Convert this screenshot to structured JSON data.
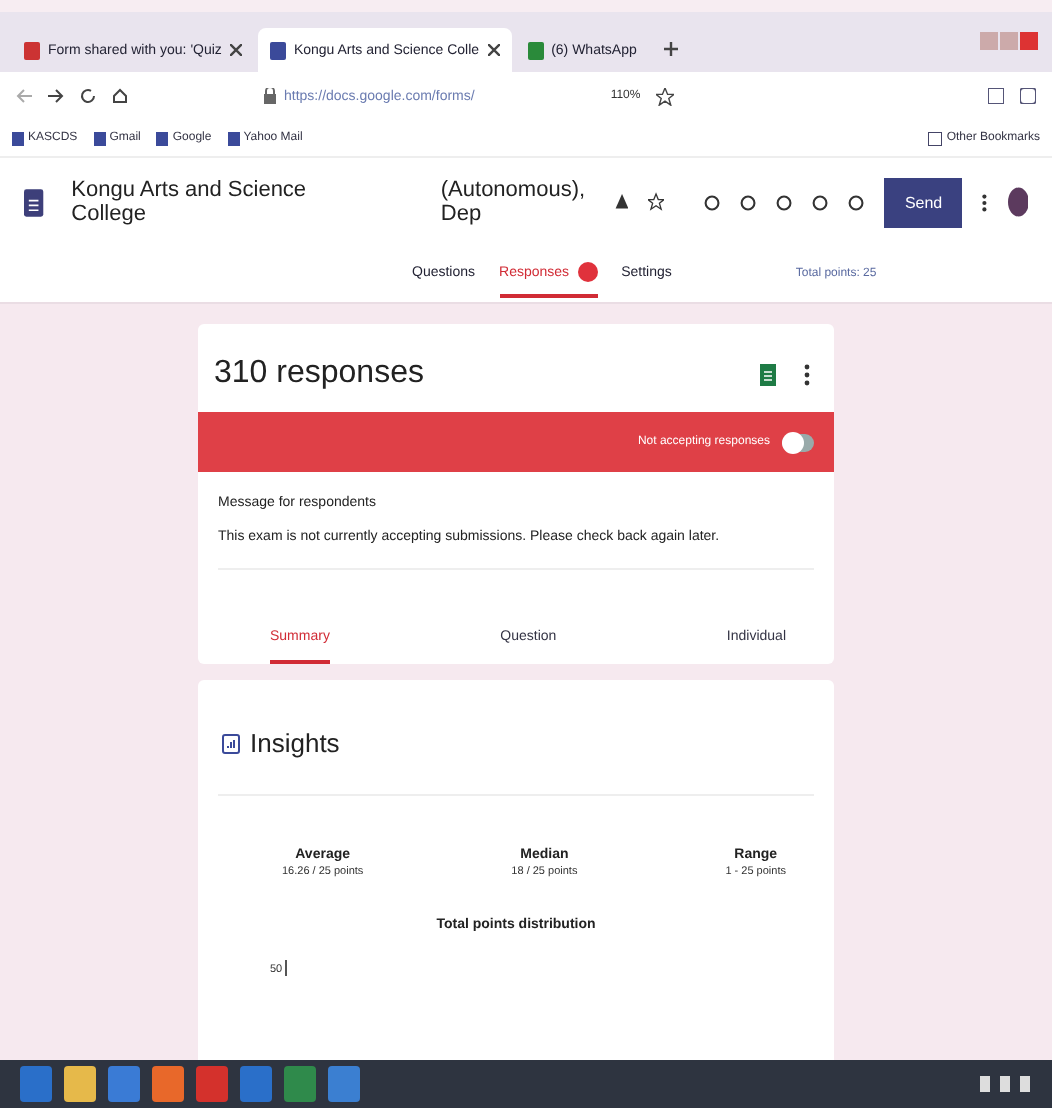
{
  "browser": {
    "tabs": [
      {
        "label": "Form shared with you: 'Quiz",
        "selected": false
      },
      {
        "label": "Kongu Arts and Science Colle",
        "selected": true
      },
      {
        "label": "(6) WhatsApp",
        "selected": false
      }
    ],
    "address": "https://docs.google.com/forms/",
    "zoom": "110%",
    "bookmarks": [
      "KASCDS",
      "Gmail",
      "Google",
      "Yahoo Mail"
    ],
    "other_bookmarks": "Other Bookmarks"
  },
  "header": {
    "title": "Kongu Arts and Science College",
    "subtitle": "(Autonomous), Dep",
    "send": "Send"
  },
  "nav": {
    "tabs": [
      {
        "label": "Questions",
        "selected": false,
        "badge": false
      },
      {
        "label": "Responses",
        "selected": true,
        "badge": true
      },
      {
        "label": "Settings",
        "selected": false,
        "badge": false
      }
    ],
    "total_points": "Total points: 25"
  },
  "responses": {
    "count": "310 responses",
    "banner": "Not accepting responses",
    "accepting": false,
    "message_label": "Message for respondents",
    "message": "This exam is not currently accepting submissions. Please check back again later.",
    "tabs": [
      {
        "label": "Summary",
        "selected": true
      },
      {
        "label": "Question",
        "selected": false
      },
      {
        "label": "Individual",
        "selected": false
      }
    ]
  },
  "insights": {
    "title": "Insights",
    "stats": [
      {
        "label": "Average",
        "value": "16.26 / 25 points"
      },
      {
        "label": "Median",
        "value": "18 / 25 points"
      },
      {
        "label": "Range",
        "value": "1 - 25 points"
      }
    ],
    "distribution_title": "Total points distribution",
    "axis_tick": "50"
  }
}
